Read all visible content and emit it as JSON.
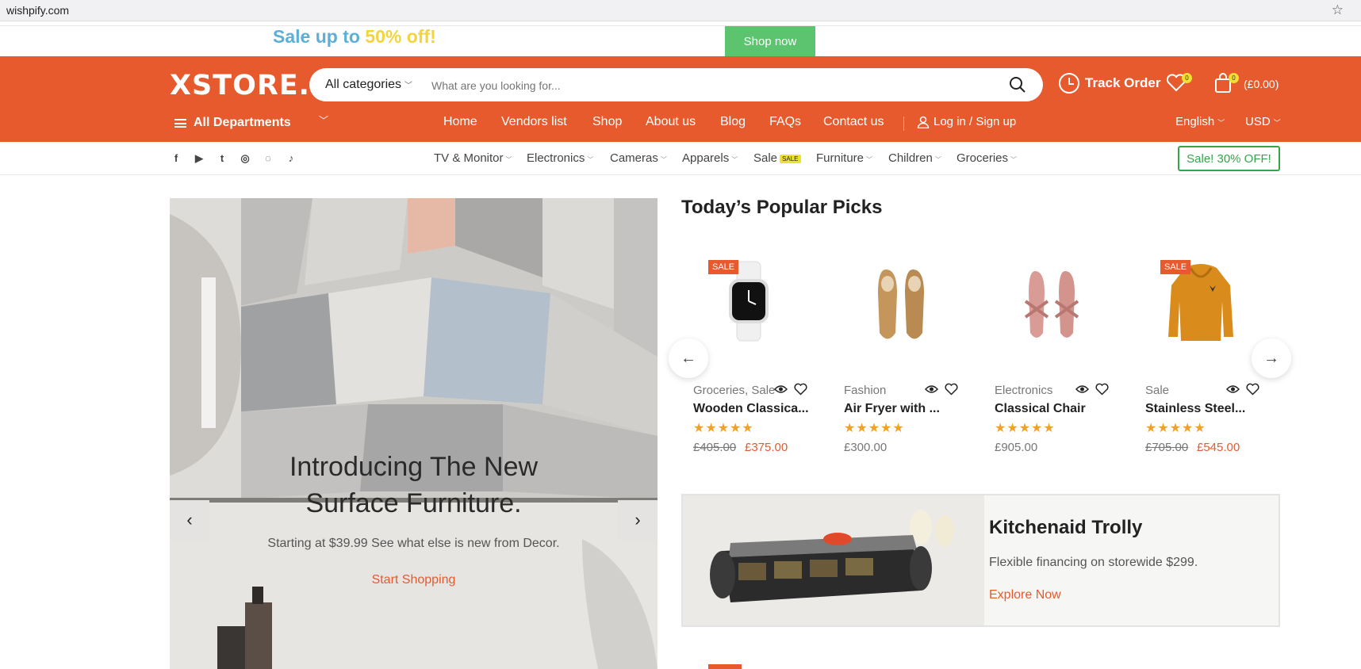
{
  "browser": {
    "url": "wishpify.com"
  },
  "promo": {
    "text_start": "Sale up to ",
    "text_highlight": "50% off!",
    "button": "Shop now"
  },
  "header": {
    "logo": "XSTORE.",
    "search": {
      "category": "All categories",
      "placeholder": "What are you looking for..."
    },
    "track_order": "Track Order",
    "wishlist_count": "0",
    "cart_count": "0",
    "cart_total": "(£0.00)",
    "departments": "All Departments",
    "nav": [
      "Home",
      "Vendors list",
      "Shop",
      "About us",
      "Blog",
      "FAQs",
      "Contact us"
    ],
    "login": "Log in / Sign up",
    "language": "English",
    "currency": "USD"
  },
  "category_bar": {
    "social": [
      "f",
      "▶",
      "t",
      "◎",
      "◌",
      "♪"
    ],
    "categories": [
      "TV & Monitor",
      "Electronics",
      "Cameras",
      "Apparels",
      "Sale",
      "Furniture",
      "Children",
      "Groceries"
    ],
    "sale_tag": "SALE",
    "sale_button": "Sale! 30% OFF!"
  },
  "hero": {
    "title_line1": "Introducing The New",
    "title_line2": "Surface Furniture.",
    "subtitle": "Starting at $39.99 See what else is new from Decor.",
    "cta": "Start Shopping"
  },
  "popular": {
    "title": "Today’s Popular Picks",
    "products": [
      {
        "badge": "SALE",
        "category": "Groceries, Sale",
        "name": "Wooden Classica...",
        "rating": 5,
        "old_price": "£405.00",
        "price": "£375.00"
      },
      {
        "badge": "",
        "category": "Fashion",
        "name": "Air Fryer with ...",
        "rating": 5,
        "old_price": "",
        "price": "£300.00"
      },
      {
        "badge": "",
        "category": "Electronics",
        "name": "Classical Chair",
        "rating": 5,
        "old_price": "",
        "price": "£905.00"
      },
      {
        "badge": "SALE",
        "category": "Sale",
        "name": "Stainless Steel...",
        "rating": 5,
        "old_price": "£705.00",
        "price": "£545.00"
      }
    ],
    "stars": "★★★★★"
  },
  "banner": {
    "title": "Kitchenaid Trolly",
    "subtitle": "Flexible financing on storewide $299.",
    "cta": "Explore Now"
  },
  "colors": {
    "brand": "#e65a2e",
    "promo_blue": "#5dafd8",
    "promo_yellow": "#f2d43c",
    "green": "#5cc46f",
    "star": "#f2a128"
  }
}
